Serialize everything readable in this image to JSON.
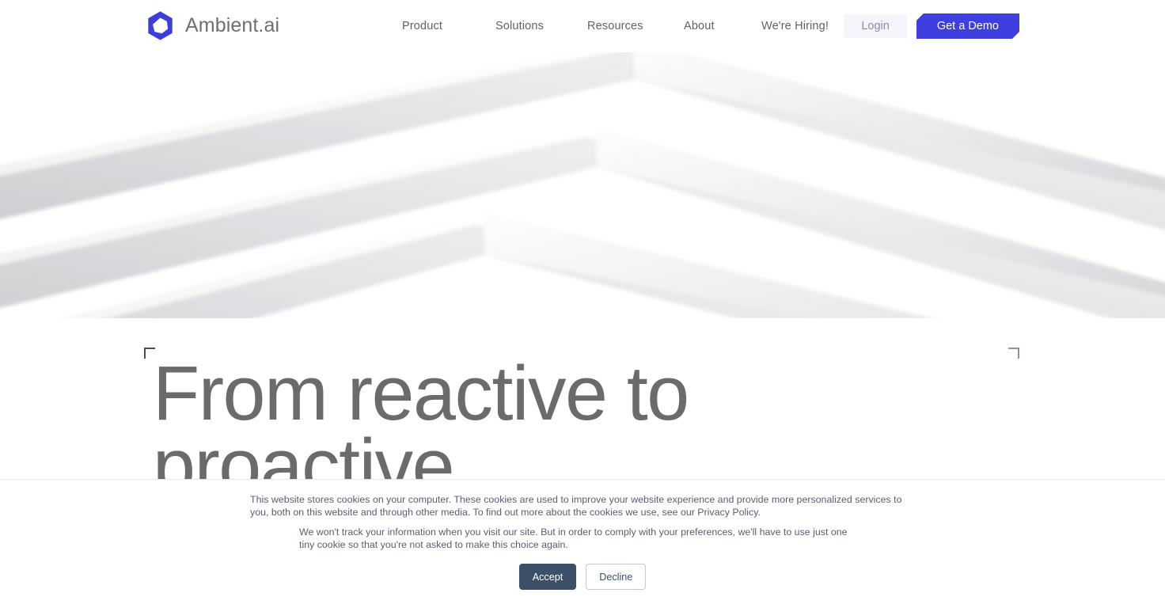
{
  "site": {
    "brand_name": "Ambient.ai",
    "logo_icon": "hexagon-ring-logo-icon"
  },
  "colors": {
    "brand_blue": "#3f3fe0",
    "logo_blue": "#3b3fd8",
    "headline_gray": "#6b6b6b",
    "nav_text": "#5f6368",
    "login_bg": "#f4f4fb",
    "login_text": "#8b8fa8",
    "accept_bg": "#3c5069",
    "decline_border": "#c3c9d1",
    "banner_border": "#e6e6ea",
    "corner_bracket_dark": "#4b4b66",
    "corner_bracket_light": "#8e8ea8"
  },
  "nav": {
    "items": [
      {
        "label": "Product"
      },
      {
        "label": "Solutions"
      },
      {
        "label": "Resources"
      },
      {
        "label": "About"
      },
      {
        "label": "We're Hiring!"
      }
    ]
  },
  "header_actions": {
    "login_label": "Login",
    "demo_label": "Get a Demo"
  },
  "hero": {
    "title": "From reactive to\nproactive",
    "background_art": "three-stacked-white-chevrons"
  },
  "cookie_banner": {
    "paragraph_1": "This website stores cookies on your computer. These cookies are used to improve your website experience and provide more personalized services to you, both on this website and through other media. To find out more about the cookies we use, see our Privacy Policy.",
    "paragraph_2": "We won't track your information when you visit our site. But in order to comply with your preferences, we'll have to use just one tiny cookie so that you're not asked to make this choice again.",
    "accept_label": "Accept",
    "decline_label": "Decline"
  }
}
